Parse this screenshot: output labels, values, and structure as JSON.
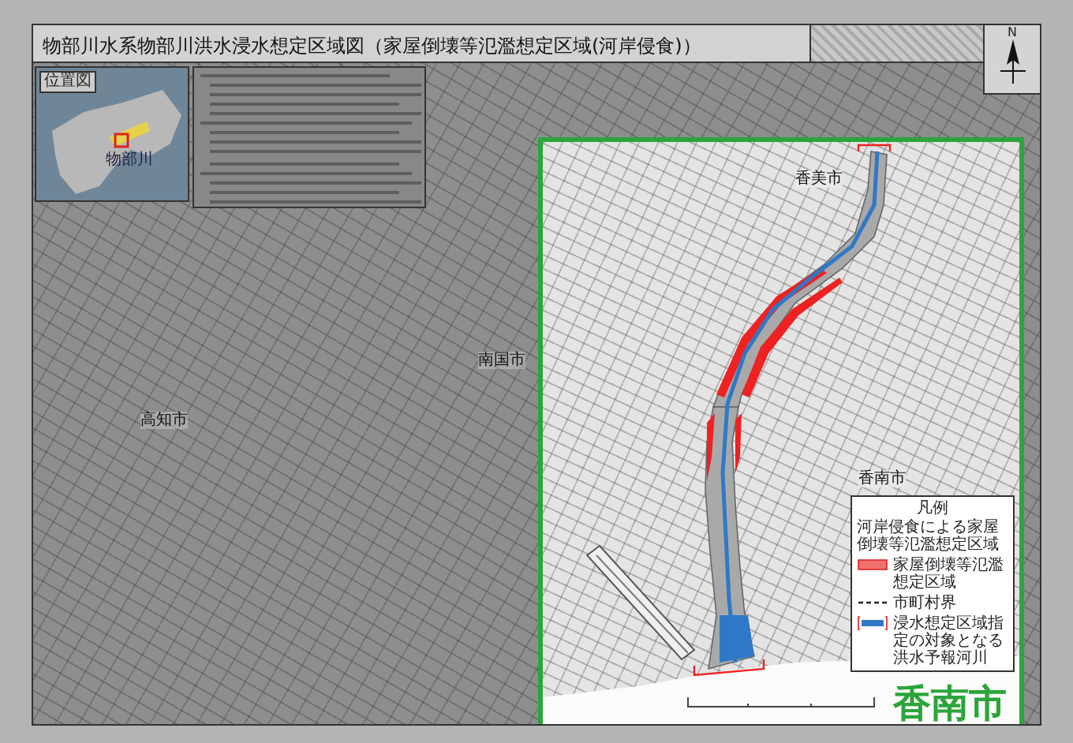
{
  "title": "物部川水系物部川洪水浸水想定区域図（家屋倒壊等氾濫想定区域(河岸侵食)）",
  "compass": {
    "label": "N"
  },
  "location_map": {
    "title": "位置図",
    "river_label": "物部川"
  },
  "place_labels": [
    {
      "text": "南国市"
    },
    {
      "text": "高知市"
    }
  ],
  "highlight": {
    "place_labels": [
      {
        "text": "香美市"
      },
      {
        "text": "香南市"
      }
    ],
    "legend": {
      "title": "凡例",
      "subtitle": "河岸侵食による家屋倒壊等氾濫想定区域",
      "items": [
        {
          "kind": "fill",
          "label": "家屋倒壊等氾濫想定区域"
        },
        {
          "kind": "dash",
          "label": "市町村界"
        },
        {
          "kind": "river",
          "label": "浸水想定区域指定の対象となる洪水予報河川"
        }
      ]
    },
    "big_label": "香南市"
  }
}
